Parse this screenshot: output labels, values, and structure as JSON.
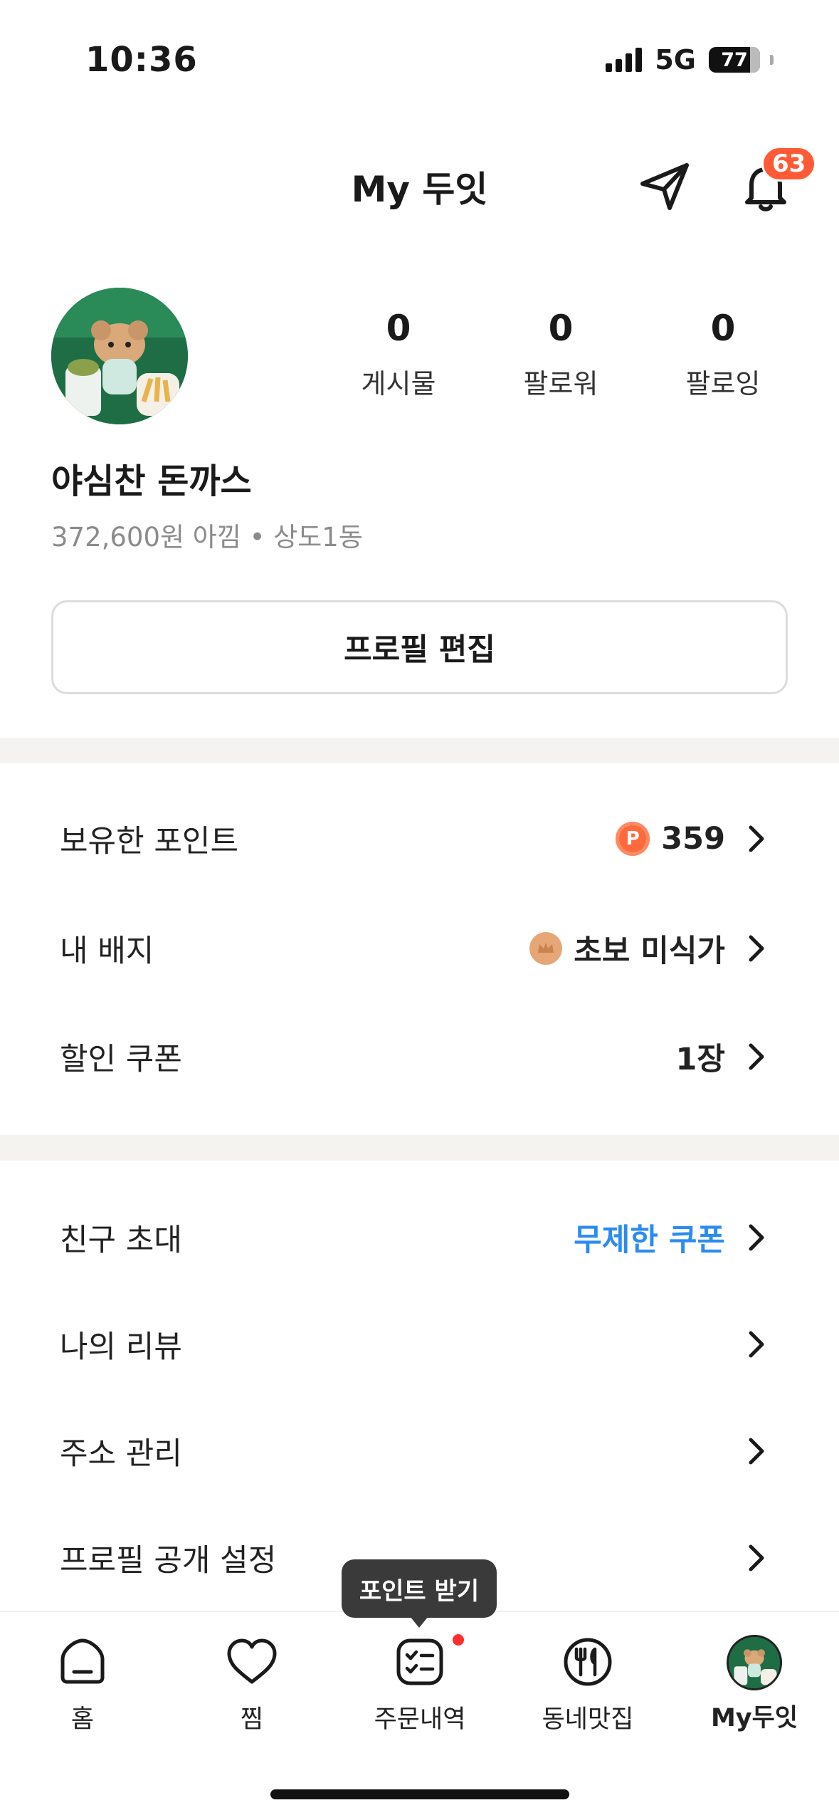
{
  "status_bar": {
    "time": "10:36",
    "network": "5G",
    "battery": "77"
  },
  "header": {
    "title": "My 두잇",
    "notification_count": "63"
  },
  "profile": {
    "nickname": "야심찬 돈까스",
    "savings_info": "372,600원 아낌 • 상도1동",
    "stats": [
      {
        "value": "0",
        "label": "게시물"
      },
      {
        "value": "0",
        "label": "팔로워"
      },
      {
        "value": "0",
        "label": "팔로잉"
      }
    ],
    "edit_button": "프로필 편집"
  },
  "section1": {
    "points": {
      "label": "보유한 포인트",
      "coin_letter": "P",
      "value": "359"
    },
    "badge": {
      "label": "내 배지",
      "value": "초보 미식가"
    },
    "coupon": {
      "label": "할인 쿠폰",
      "value": "1장"
    }
  },
  "section2": {
    "invite": {
      "label": "친구 초대",
      "value": "무제한 쿠폰"
    },
    "reviews": {
      "label": "나의 리뷰"
    },
    "address": {
      "label": "주소 관리"
    },
    "privacy": {
      "label": "프로필 공개 설정"
    }
  },
  "tooltip": "포인트 받기",
  "tabs": [
    {
      "label": "홈"
    },
    {
      "label": "찜"
    },
    {
      "label": "주문내역"
    },
    {
      "label": "동네맛집"
    },
    {
      "label": "My두잇"
    }
  ],
  "colors": {
    "accent_blue": "#2b8cf0",
    "badge_red": "#ff5a36",
    "point_orange": "#ff6a3d"
  }
}
